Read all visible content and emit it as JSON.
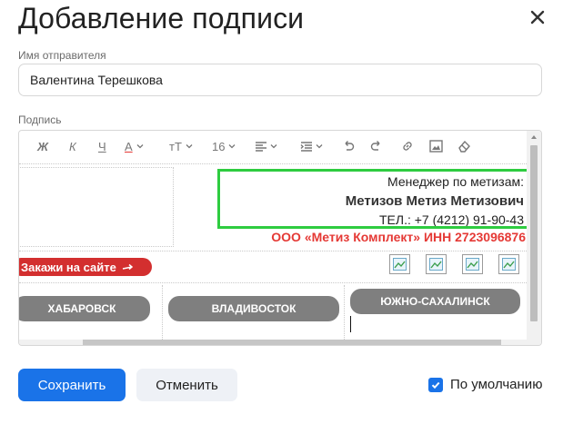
{
  "dialog": {
    "title": "Добавление подписи",
    "close_icon": "close-icon"
  },
  "sender": {
    "label": "Имя отправителя",
    "value": "Валентина Терешкова"
  },
  "signature": {
    "label": "Подпись",
    "toolbar": {
      "bold": "Ж",
      "italic": "К",
      "underline": "Ч",
      "text_color": "A",
      "font_size_icon": "тТ",
      "font_size_value": "16",
      "icons": [
        "align-left-icon",
        "indent-icon",
        "undo-icon",
        "redo-icon",
        "link-icon",
        "image-icon",
        "clear-format-icon"
      ]
    },
    "content": {
      "manager": "Менеджер по метизам:",
      "name": "Метизов Метиз Метизович",
      "phone": "ТЕЛ.: +7 (4212) 91-90-43",
      "company": "ООО «Метиз Комплект» ИНН 2723096876",
      "order_button": "Закажи на сайте",
      "cities": [
        "ХАБАРОВСК",
        "ВЛАДИВОСТОК",
        "ЮЖНО-САХАЛИНСК"
      ]
    }
  },
  "actions": {
    "save": "Сохранить",
    "cancel": "Отменить",
    "default_label": "По умолчанию",
    "default_checked": true
  },
  "colors": {
    "primary": "#1a73e8",
    "company_red": "#e53935",
    "highlight": "#2ecc40",
    "city_pill": "#7f7f7f"
  }
}
